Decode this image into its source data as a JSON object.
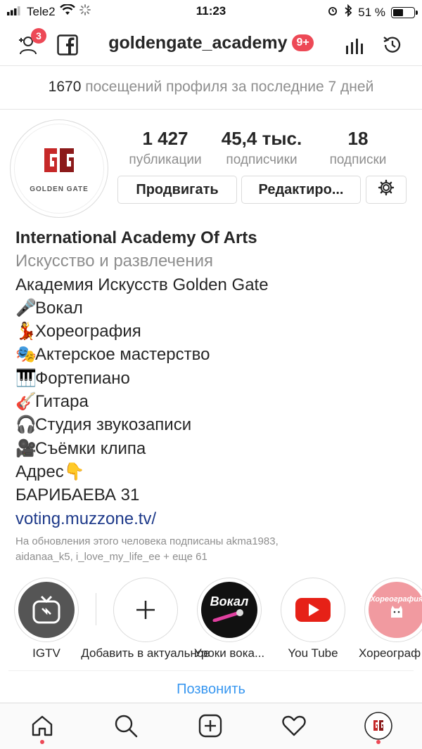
{
  "status_bar": {
    "carrier": "Tele2",
    "time": "11:23",
    "battery_percent_label": "51 %",
    "battery_level": 0.51
  },
  "header": {
    "username": "goldengate_academy",
    "notification_badge": "9+",
    "add_people_badge": "3",
    "icons": [
      "add-person-icon",
      "facebook-icon",
      "insights-icon",
      "archive-history-icon"
    ]
  },
  "visits": {
    "count": "1670",
    "text": "посещений профиля за последние 7 дней"
  },
  "avatar": {
    "logo_text": "GOLDEN GATE"
  },
  "stats": [
    {
      "value": "1 427",
      "label": "публикации"
    },
    {
      "value": "45,4 тыс.",
      "label": "подписчики"
    },
    {
      "value": "18",
      "label": "подписки"
    }
  ],
  "buttons": {
    "promote": "Продвигать",
    "edit": "Редактиро..."
  },
  "bio": {
    "name": "International Academy Of Arts",
    "category": "Искусство и развлечения",
    "line1": "Академия Искусств Golden Gate",
    "items": [
      {
        "emoji": "🎤",
        "text": "Вокал"
      },
      {
        "emoji": "💃",
        "text": "Хореография"
      },
      {
        "emoji": "🎭",
        "text": "Актерское мастерство"
      },
      {
        "emoji": "🎹",
        "text": "Фортепиано"
      },
      {
        "emoji": "🎸",
        "text": "Гитара"
      },
      {
        "emoji": "🎧",
        "text": "Студия звукозаписи"
      },
      {
        "emoji": "🎥",
        "text": "Съёмки клипа"
      }
    ],
    "address_label": "Адрес",
    "address_emoji": "👇",
    "address": "БАРИБАЕВА 31",
    "link": "voting.muzzone.tv/"
  },
  "followed_by": {
    "line1": "На обновления этого человека подписаны akma1983,",
    "line2": "aidanaa_k5, i_love_my_life_ee + еще 61"
  },
  "highlights": [
    {
      "label": "IGTV"
    },
    {
      "label": "Добавить в актуальное"
    },
    {
      "label": "Уроки вока...",
      "cover_text": "Вокал"
    },
    {
      "label": "You Tube"
    },
    {
      "label": "Хореограф",
      "cover_text": "Хореография"
    }
  ],
  "call_button": "Позвонить",
  "colors": {
    "accent_blue": "#3897f0",
    "badge_red": "#ed4956",
    "logo_red": "#c62828",
    "youtube_red": "#e62117",
    "choreo_pink": "#f19aa0"
  },
  "bottom_nav": [
    "home-icon",
    "search-icon",
    "new-post-icon",
    "activity-heart-icon",
    "profile-avatar-icon"
  ]
}
